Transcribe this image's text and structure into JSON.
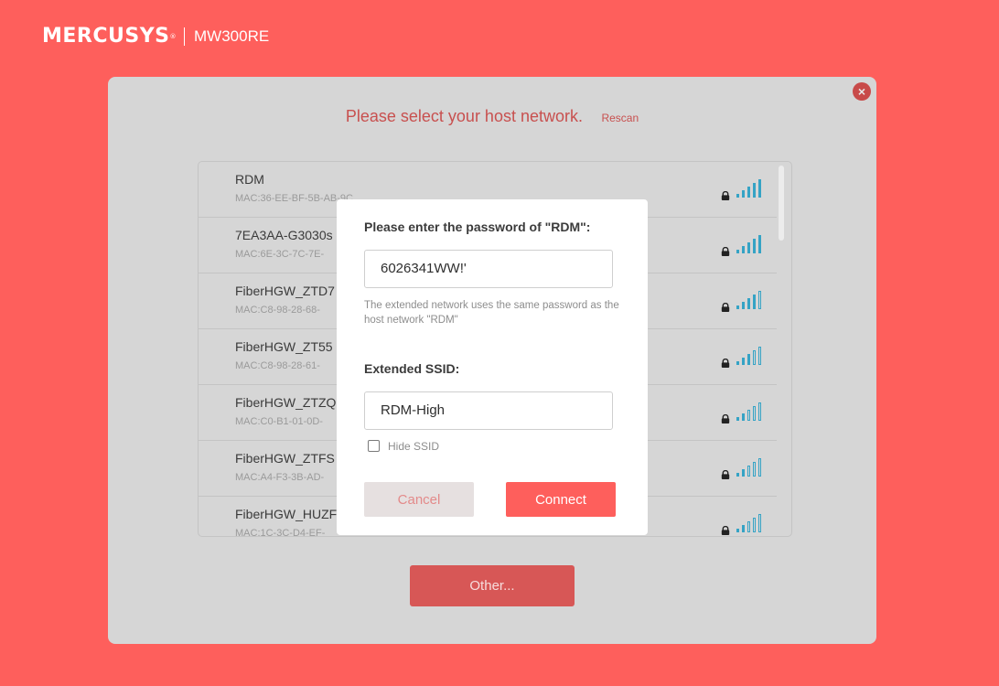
{
  "header": {
    "brand": "MERCUSYS",
    "trademark": "®",
    "model": "MW300RE"
  },
  "panel": {
    "title": "Please select your host network.",
    "rescan_label": "Rescan",
    "close_icon": "×",
    "other_label": "Other..."
  },
  "networks": [
    {
      "name": "RDM",
      "mac": "MAC:36-EE-BF-5B-AB-9C",
      "secured": true,
      "signal_bars": 5
    },
    {
      "name": "7EA3AA-G3030s",
      "mac": "MAC:6E-3C-7C-7E-",
      "secured": true,
      "signal_bars": 5
    },
    {
      "name": "FiberHGW_ZTD7",
      "mac": "MAC:C8-98-28-68-",
      "secured": true,
      "signal_bars": 4
    },
    {
      "name": "FiberHGW_ZT55",
      "mac": "MAC:C8-98-28-61-",
      "secured": true,
      "signal_bars": 3
    },
    {
      "name": "FiberHGW_ZTZQ",
      "mac": "MAC:C0-B1-01-0D-",
      "secured": true,
      "signal_bars": 2
    },
    {
      "name": "FiberHGW_ZTFS",
      "mac": "MAC:A4-F3-3B-AD-",
      "secured": true,
      "signal_bars": 2
    },
    {
      "name": "FiberHGW_HUZF",
      "mac": "MAC:1C-3C-D4-EF-",
      "secured": true,
      "signal_bars": 2
    }
  ],
  "dialog": {
    "password_label": "Please enter the password of \"RDM\":",
    "password_value": "6026341WW!'",
    "hint": "The extended network uses the same password as the host network \"RDM\"",
    "ssid_label": "Extended SSID:",
    "ssid_value": "RDM-High",
    "hide_ssid_label": "Hide SSID",
    "hide_ssid_checked": false,
    "cancel_label": "Cancel",
    "connect_label": "Connect"
  },
  "colors": {
    "background": "#fe5f5c",
    "panel": "#d6d6d6",
    "signal": "#35a3c5",
    "accent_text": "#c8504f"
  },
  "icons": {
    "lock": "lock-icon",
    "wifi": "wifi-signal-icon",
    "close": "close-icon"
  }
}
